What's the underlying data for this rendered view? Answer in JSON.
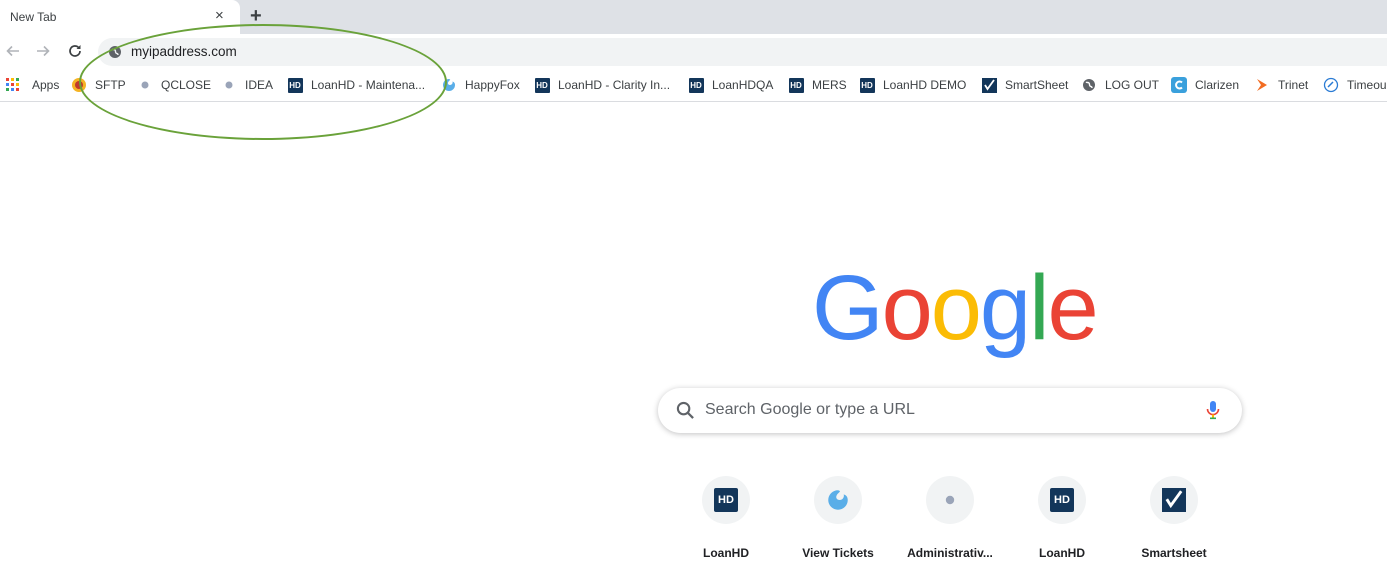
{
  "tab": {
    "title": "New Tab",
    "close": "×",
    "new_tab": "+"
  },
  "omnibox": {
    "url": "myipaddress.com"
  },
  "bookmarks": [
    {
      "label": "Apps",
      "icon": "apps-grid-icon"
    },
    {
      "label": "SFTP",
      "icon": "sftp-icon"
    },
    {
      "label": "QCLOSE",
      "icon": "small-logo-icon"
    },
    {
      "label": "IDEA",
      "icon": "small-logo-icon"
    },
    {
      "label": "LoanHD - Maintena...",
      "icon": "hd-icon"
    },
    {
      "label": "HappyFox",
      "icon": "happyfox-icon"
    },
    {
      "label": "LoanHD - Clarity In...",
      "icon": "hd-icon"
    },
    {
      "label": "LoanHDQA",
      "icon": "hd-icon"
    },
    {
      "label": "MERS",
      "icon": "hd-icon"
    },
    {
      "label": "LoanHD DEMO",
      "icon": "hd-icon"
    },
    {
      "label": "SmartSheet",
      "icon": "smartsheet-icon"
    },
    {
      "label": "LOG OUT",
      "icon": "globe-icon"
    },
    {
      "label": "Clarizen",
      "icon": "clarizen-icon"
    },
    {
      "label": "Trinet",
      "icon": "trinet-icon"
    },
    {
      "label": "Timeou",
      "icon": "timeout-icon"
    }
  ],
  "hd_icon_text": "HD",
  "logo": {
    "letters": [
      "G",
      "o",
      "o",
      "g",
      "l",
      "e"
    ],
    "colors": [
      "#4285f4",
      "#ea4335",
      "#fbbc05",
      "#4285f4",
      "#34a853",
      "#ea4335"
    ]
  },
  "search": {
    "placeholder": "Search Google or type a URL"
  },
  "shortcuts": [
    {
      "label": "LoanHD",
      "icon": "hd-icon"
    },
    {
      "label": "View Tickets",
      "icon": "happyfox-icon"
    },
    {
      "label": "Administrativ...",
      "icon": "small-logo-icon"
    },
    {
      "label": "LoanHD",
      "icon": "hd-icon"
    },
    {
      "label": "Smartsheet",
      "icon": "smartsheet-icon"
    }
  ],
  "colors": {
    "annotation": "#6aa23a",
    "hd_brand": "#13365a"
  }
}
